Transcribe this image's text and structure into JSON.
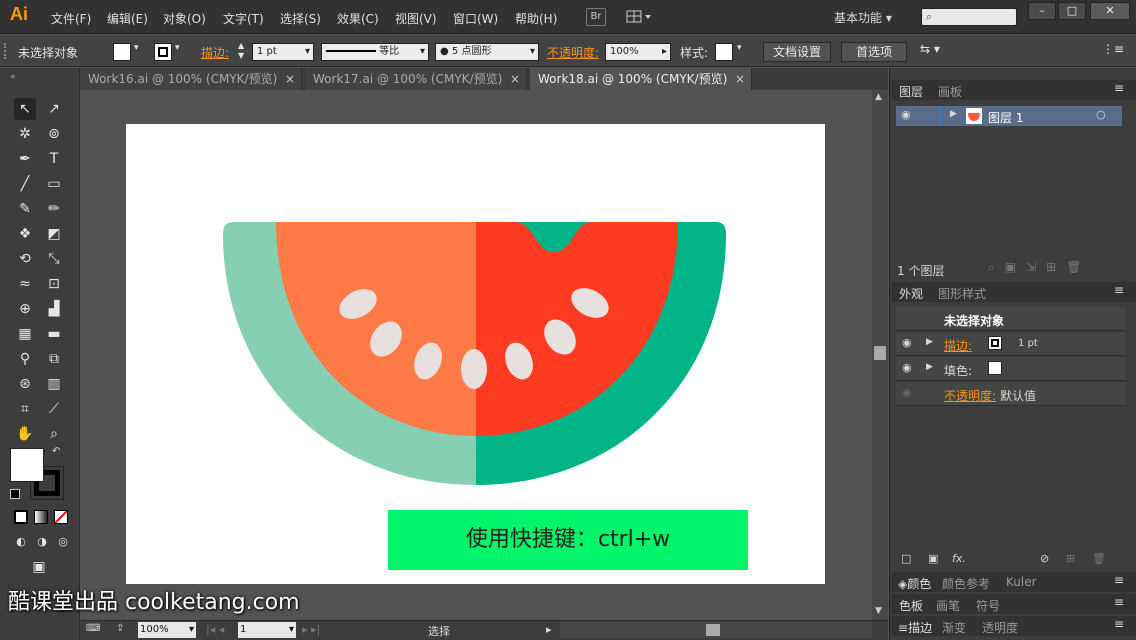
{
  "app": {
    "logo": "Ai",
    "menu": [
      "文件(F)",
      "编辑(E)",
      "对象(O)",
      "文字(T)",
      "选择(S)",
      "效果(C)",
      "视图(V)",
      "窗口(W)",
      "帮助(H)"
    ],
    "br_button": "Br",
    "workspace": "基本功能",
    "window_controls": [
      "–",
      "□",
      "✕"
    ]
  },
  "control_bar": {
    "no_selection": "未选择对象",
    "stroke_label": "描边:",
    "stroke_weight": "1 pt",
    "stroke_profile": "等比",
    "brush": "5 点圆形",
    "opacity_label": "不透明度:",
    "opacity_value": "100%",
    "style_label": "样式:",
    "doc_setup": "文档设置",
    "preferences": "首选项"
  },
  "tabs": [
    {
      "label": "Work16.ai @ 100% (CMYK/预览)",
      "close": "×"
    },
    {
      "label": "Work17.ai @ 100% (CMYK/预览)",
      "close": "×"
    },
    {
      "label": "Work18.ai @ 100% (CMYK/预览)",
      "close": "×"
    }
  ],
  "status": {
    "zoom": "100%",
    "page": "1",
    "mode": "选择"
  },
  "layers_panel": {
    "tabs": [
      "图层",
      "画板"
    ],
    "layer_name": "图层 1",
    "count": "1 个图层"
  },
  "appearance_panel": {
    "tabs": [
      "外观",
      "图形样式"
    ],
    "title": "未选择对象",
    "stroke_label": "描边:",
    "stroke_value": "1 pt",
    "fill_label": "填色:",
    "opacity_label": "不透明度:",
    "opacity_value": "默认值",
    "fx": "fx."
  },
  "bottom_tabs": {
    "row1": [
      "颜色",
      "颜色参考",
      "Kuler"
    ],
    "row2": [
      "色板",
      "画笔",
      "符号"
    ],
    "row3": [
      "描边",
      "渐变",
      "透明度"
    ]
  },
  "overlay": {
    "shortcut": "使用快捷键：ctrl+w",
    "watermark": "酷课堂出品 coolketang.com"
  },
  "colors": {
    "rind_light": "#86cfb2",
    "rind_dark": "#00b488",
    "flesh_light": "#ff7a47",
    "flesh_dark": "#ff3c22",
    "seed": "#e8e0de",
    "shortcut_bg": "#00f56a"
  }
}
